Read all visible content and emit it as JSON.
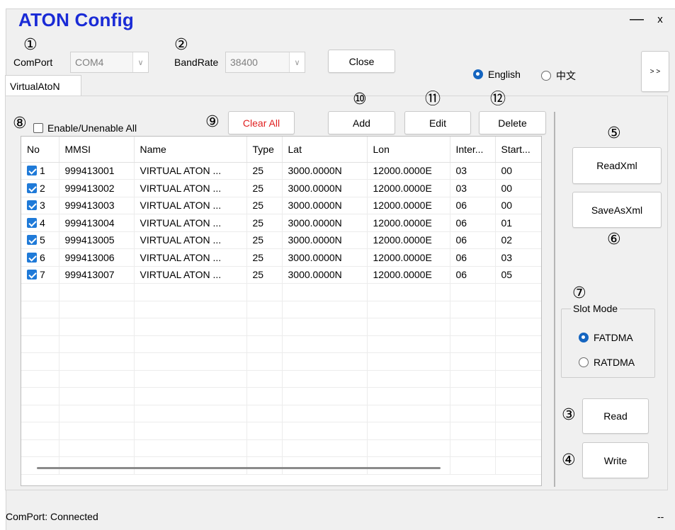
{
  "app": {
    "title": "ATON Config",
    "minimize": "—",
    "close": "x"
  },
  "annotations": [
    "①",
    "②",
    "③",
    "④",
    "⑤",
    "⑥",
    "⑦",
    "⑧",
    "⑨",
    "⑩",
    "⑪",
    "⑫"
  ],
  "connection": {
    "comport_label": "ComPort",
    "comport_value": "COM4",
    "bandrate_label": "BandRate",
    "bandrate_value": "38400",
    "close_button": "Close",
    "expand_button": "> >"
  },
  "language": {
    "options": [
      "English",
      "中文"
    ],
    "selected": "English"
  },
  "tab": {
    "label": "VirtualAtoN"
  },
  "toolbar": {
    "enable_all_label": "Enable/Unenable All",
    "clear_all": "Clear All",
    "add": "Add",
    "edit": "Edit",
    "delete": "Delete"
  },
  "table": {
    "columns": [
      "No",
      "MMSI",
      "Name",
      "Type",
      "Lat",
      "Lon",
      "Inter...",
      "Start..."
    ],
    "rows": [
      {
        "no": "1",
        "checked": true,
        "mmsi": "999413001",
        "name": "VIRTUAL ATON ...",
        "type": "25",
        "lat": "3000.0000N",
        "lon": "12000.0000E",
        "inter": "03",
        "start": "00"
      },
      {
        "no": "2",
        "checked": true,
        "mmsi": "999413002",
        "name": "VIRTUAL ATON ...",
        "type": "25",
        "lat": "3000.0000N",
        "lon": "12000.0000E",
        "inter": "03",
        "start": "00"
      },
      {
        "no": "3",
        "checked": true,
        "mmsi": "999413003",
        "name": "VIRTUAL ATON ...",
        "type": "25",
        "lat": "3000.0000N",
        "lon": "12000.0000E",
        "inter": "06",
        "start": "00"
      },
      {
        "no": "4",
        "checked": true,
        "mmsi": "999413004",
        "name": "VIRTUAL ATON ...",
        "type": "25",
        "lat": "3000.0000N",
        "lon": "12000.0000E",
        "inter": "06",
        "start": "01"
      },
      {
        "no": "5",
        "checked": true,
        "mmsi": "999413005",
        "name": "VIRTUAL ATON ...",
        "type": "25",
        "lat": "3000.0000N",
        "lon": "12000.0000E",
        "inter": "06",
        "start": "02"
      },
      {
        "no": "6",
        "checked": true,
        "mmsi": "999413006",
        "name": "VIRTUAL ATON ...",
        "type": "25",
        "lat": "3000.0000N",
        "lon": "12000.0000E",
        "inter": "06",
        "start": "03"
      },
      {
        "no": "7",
        "checked": true,
        "mmsi": "999413007",
        "name": "VIRTUAL ATON ...",
        "type": "25",
        "lat": "3000.0000N",
        "lon": "12000.0000E",
        "inter": "06",
        "start": "05"
      }
    ]
  },
  "side": {
    "read_xml": "ReadXml",
    "save_as_xml": "SaveAsXml",
    "slot_mode_title": "Slot Mode",
    "slot_mode_options": [
      "FATDMA",
      "RATDMA"
    ],
    "slot_mode_selected": "FATDMA",
    "read": "Read",
    "write": "Write"
  },
  "status": {
    "text": "ComPort: Connected",
    "right": "--"
  },
  "colors": {
    "title": "#1a2bd6",
    "accent": "#1565c0",
    "danger": "#e02020"
  }
}
